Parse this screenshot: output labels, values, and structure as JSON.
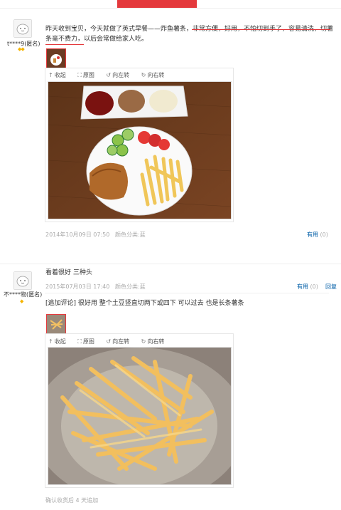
{
  "review1": {
    "username": "t****9(匿名)",
    "text_part1": "昨天收到宝贝，今天就做了英式早餐——炸鱼薯条，",
    "text_underlined": "非常方便，好用，不怕切到手了，容易清洗，切薯条毫不费力",
    "text_part2": "，以后会常做给家人吃。",
    "tools": [
      "收起",
      "原图",
      "向左转",
      "向右转"
    ],
    "date": "2014年10月09日 07:50",
    "color_label": "颜色分类:",
    "color_value": "蓝",
    "useful_label": "有用",
    "useful_count": "(0)"
  },
  "review2": {
    "username": "不****物(匿名)",
    "text": "看着很好 三种头",
    "date": "2015年07月03日 17:40",
    "color_label": "颜色分类:",
    "color_value": "蓝",
    "useful_label": "有用",
    "useful_count": "(0)",
    "reply_label": "回复",
    "followup_text": "[追加评论] 很好用 整个土豆竖直切两下或四下 可以过去 也是长条薯条",
    "tools": [
      "收起",
      "原图",
      "向左转",
      "向右转"
    ],
    "followup_meta": "确认收货后 4 天追加"
  },
  "colors": {
    "accent": "#e4393c",
    "link": "#005ea7",
    "muted": "#aaaaaa"
  }
}
